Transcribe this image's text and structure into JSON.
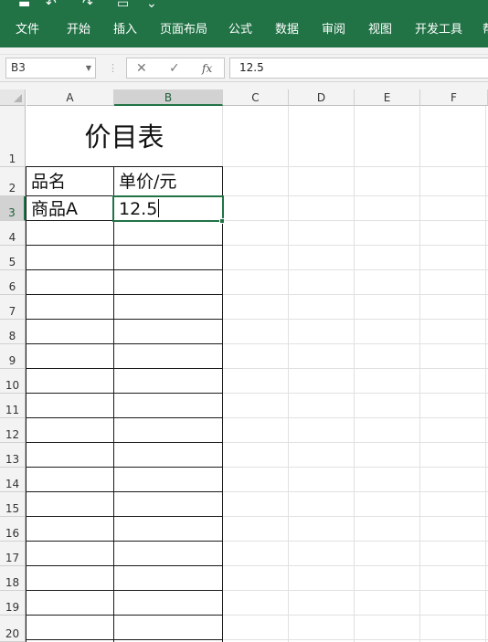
{
  "ribbon": {
    "tabs": [
      {
        "id": "file",
        "label": "文件"
      },
      {
        "id": "home",
        "label": "开始"
      },
      {
        "id": "insert",
        "label": "插入"
      },
      {
        "id": "page-layout",
        "label": "页面布局"
      },
      {
        "id": "formulas",
        "label": "公式"
      },
      {
        "id": "data",
        "label": "数据"
      },
      {
        "id": "review",
        "label": "审阅"
      },
      {
        "id": "view",
        "label": "视图"
      },
      {
        "id": "developer",
        "label": "开发工具"
      },
      {
        "id": "help",
        "label": "帮"
      }
    ]
  },
  "formula_bar": {
    "name_box": "B3",
    "value": "12.5",
    "fx_label": "fx"
  },
  "sheet": {
    "columns": [
      "A",
      "B",
      "C",
      "D",
      "E",
      "F"
    ],
    "selected_column": "B",
    "rows": [
      "1",
      "2",
      "3",
      "4",
      "5",
      "6",
      "7",
      "8",
      "9",
      "10",
      "11",
      "12",
      "13",
      "14",
      "15",
      "16",
      "17",
      "18",
      "19",
      "20"
    ],
    "selected_row": "3",
    "cells": {
      "A1": "价目表",
      "A2": "品名",
      "B2": "单价/元",
      "A3": "商品A",
      "B3": "12.5"
    }
  },
  "colors": {
    "accent": "#217346",
    "header_bg": "#f3f3f3",
    "selected_header_bg": "#d2d2d2"
  }
}
